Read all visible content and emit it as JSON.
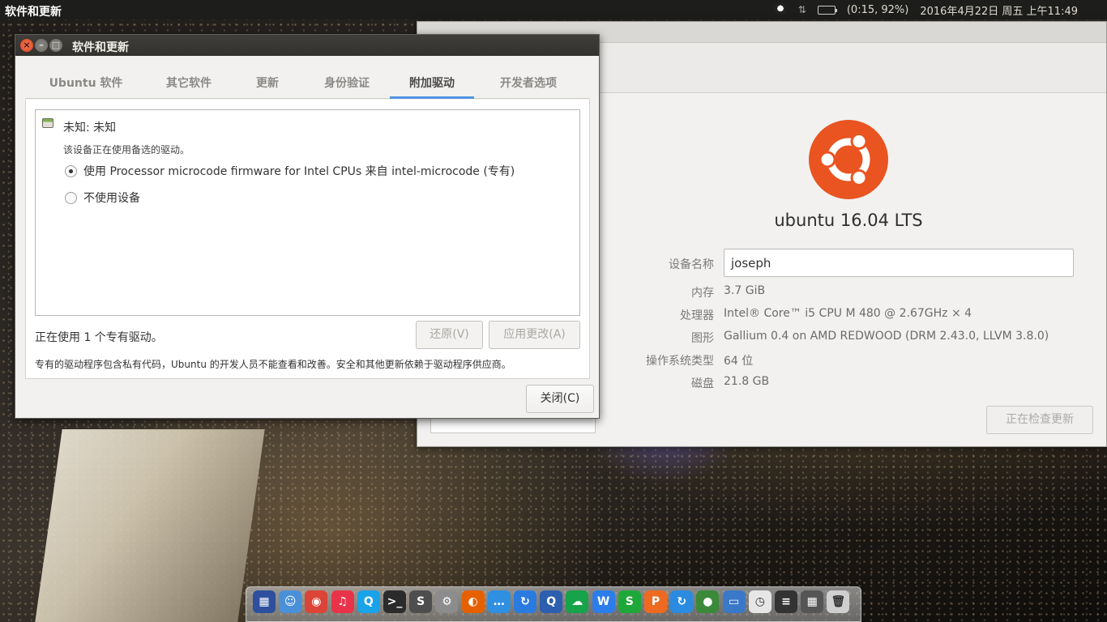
{
  "top_panel": {
    "app_title": "软件和更新",
    "battery": "(0:15, 92%)",
    "clock": "2016年4月22日 周五 上午11:49"
  },
  "software_window": {
    "title": "软件和更新",
    "tabs": [
      {
        "label": "Ubuntu 软件",
        "active": false
      },
      {
        "label": "其它软件",
        "active": false
      },
      {
        "label": "更新",
        "active": false
      },
      {
        "label": "身份验证",
        "active": false
      },
      {
        "label": "附加驱动",
        "active": true
      },
      {
        "label": "开发者选项",
        "active": false
      }
    ],
    "device": {
      "name": "未知: 未知",
      "subtitle": "该设备正在使用备选的驱动。",
      "options": [
        {
          "label": "使用 Processor microcode firmware for Intel CPUs 来自 intel-microcode (专有)",
          "selected": true
        },
        {
          "label": "不使用设备",
          "selected": false
        }
      ]
    },
    "status": "正在使用 1 个专有驱动。",
    "revert_label": "还原(V)",
    "apply_label": "应用更改(A)",
    "note": "专有的驱动程序包含私有代码，Ubuntu 的开发人员不能查看和改善。安全和其他更新依赖于驱动程序供应商。",
    "close_label": "关闭(C)"
  },
  "details_window": {
    "os_name": "ubuntu 16.04 LTS",
    "device_name_label": "设备名称",
    "device_name_value": "joseph",
    "rows": [
      {
        "label": "内存",
        "value": "3.7 GiB"
      },
      {
        "label": "处理器",
        "value": "Intel® Core™ i5 CPU M 480 @ 2.67GHz × 4"
      },
      {
        "label": "图形",
        "value": "Gallium 0.4 on AMD REDWOOD (DRM 2.43.0, LLVM 3.8.0)"
      },
      {
        "label": "操作系统类型",
        "value": "64 位"
      },
      {
        "label": "磁盘",
        "value": "21.8 GB"
      }
    ],
    "check_updates_label": "正在检查更新"
  },
  "dock": {
    "icons": [
      {
        "name": "panel-icon",
        "color": "#2d4f9e",
        "glyph": "▦"
      },
      {
        "name": "finder-icon",
        "color": "#4a90d9",
        "glyph": "☺"
      },
      {
        "name": "chrome-icon",
        "color": "#db4437",
        "glyph": "◉"
      },
      {
        "name": "music-icon",
        "color": "#e8334a",
        "glyph": "♫"
      },
      {
        "name": "qq-icon",
        "color": "#1aa3e8",
        "glyph": "Q"
      },
      {
        "name": "terminal-icon",
        "color": "#2b2b2b",
        "glyph": ">_"
      },
      {
        "name": "sublime-icon",
        "color": "#4e4e4e",
        "glyph": "S"
      },
      {
        "name": "settings-icon",
        "color": "#8c8c8c",
        "glyph": "⚙"
      },
      {
        "name": "firefox-icon",
        "color": "#e66000",
        "glyph": "◐"
      },
      {
        "name": "chat-icon",
        "color": "#2f8fe0",
        "glyph": "…"
      },
      {
        "name": "sync-icon",
        "color": "#2a7be0",
        "glyph": "↻"
      },
      {
        "name": "search-app-icon",
        "color": "#2d5fb0",
        "glyph": "Q"
      },
      {
        "name": "cloud-icon",
        "color": "#16a34a",
        "glyph": "☁"
      },
      {
        "name": "wps-writer-icon",
        "color": "#2b7de9",
        "glyph": "W"
      },
      {
        "name": "wps-sheet-icon",
        "color": "#1fa83a",
        "glyph": "S"
      },
      {
        "name": "wps-presentation-icon",
        "color": "#ee6a20",
        "glyph": "P"
      },
      {
        "name": "update-icon",
        "color": "#2a8be0",
        "glyph": "↻"
      },
      {
        "name": "globe-icon",
        "color": "#3a8a3a",
        "glyph": "●"
      },
      {
        "name": "monitor-icon",
        "color": "#3a78c8",
        "glyph": "▭"
      },
      {
        "name": "clock-icon",
        "color": "#e6e6e6",
        "glyph": "◷"
      },
      {
        "name": "system-monitor-icon",
        "color": "#333333",
        "glyph": "≡"
      },
      {
        "name": "workspace-icon",
        "color": "#555555",
        "glyph": "▦"
      },
      {
        "name": "trash-icon",
        "color": "#cfcfcf",
        "glyph": "🗑"
      }
    ]
  }
}
